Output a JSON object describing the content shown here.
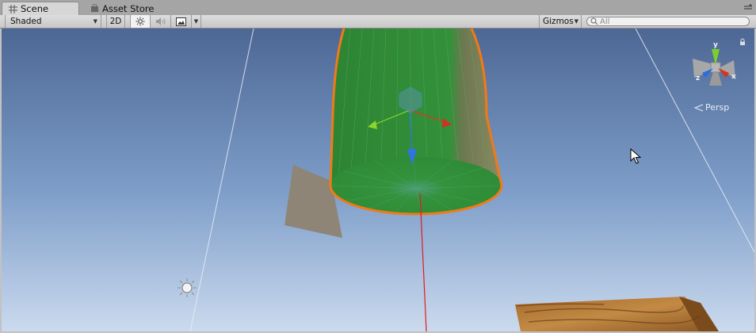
{
  "tabs": [
    {
      "label": "Scene",
      "icon": "scene-grid-icon",
      "active": true
    },
    {
      "label": "Asset Store",
      "icon": "asset-store-bag-icon",
      "active": false
    }
  ],
  "toolbar": {
    "draw_mode": "Shaded",
    "two_d_label": "2D",
    "gizmos_label": "Gizmos",
    "search_placeholder": "All"
  },
  "scene": {
    "projection_label": "Persp",
    "axis_labels": {
      "y": "y",
      "x": "x",
      "z": "z"
    },
    "colors": {
      "sky_top": "#4f6a97",
      "sky_bottom": "#c9d9ee",
      "selection_outline": "#f07a16",
      "mesh_green": "#2f8a35",
      "axis_x": "#e0361e",
      "axis_y": "#8bd62a",
      "axis_z": "#2f74e6"
    }
  }
}
